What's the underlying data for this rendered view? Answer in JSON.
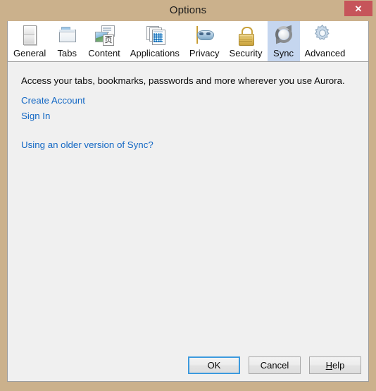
{
  "window": {
    "title": "Options",
    "close_label": "✕",
    "frame_color": "#cbb18c",
    "client_bg": "#f0f0f0",
    "close_color": "#c6555a"
  },
  "tabs": [
    {
      "label": "General",
      "icon": "window-icon",
      "selected": false
    },
    {
      "label": "Tabs",
      "icon": "folder-icon",
      "selected": false
    },
    {
      "label": "Content",
      "icon": "document-image-icon",
      "selected": false
    },
    {
      "label": "Applications",
      "icon": "app-windows-icon",
      "selected": false
    },
    {
      "label": "Privacy",
      "icon": "mask-icon",
      "selected": false
    },
    {
      "label": "Security",
      "icon": "padlock-icon",
      "selected": false
    },
    {
      "label": "Sync",
      "icon": "sync-arrows-icon",
      "selected": true
    },
    {
      "label": "Advanced",
      "icon": "gear-icon",
      "selected": false
    }
  ],
  "content": {
    "intro": "Access your tabs, bookmarks, passwords and more wherever you use Aurora.",
    "create_account_link": "Create Account",
    "sign_in_link": "Sign In",
    "older_sync_link": "Using an older version of Sync?",
    "link_color": "#1267c4",
    "content_icon_glyph": "页"
  },
  "footer": {
    "ok_label": "OK",
    "cancel_label": "Cancel",
    "help_label_prefix": "",
    "help_accel": "H",
    "help_label_rest": "elp",
    "focus_color": "#3c9ade"
  },
  "selected_tab": "Sync"
}
